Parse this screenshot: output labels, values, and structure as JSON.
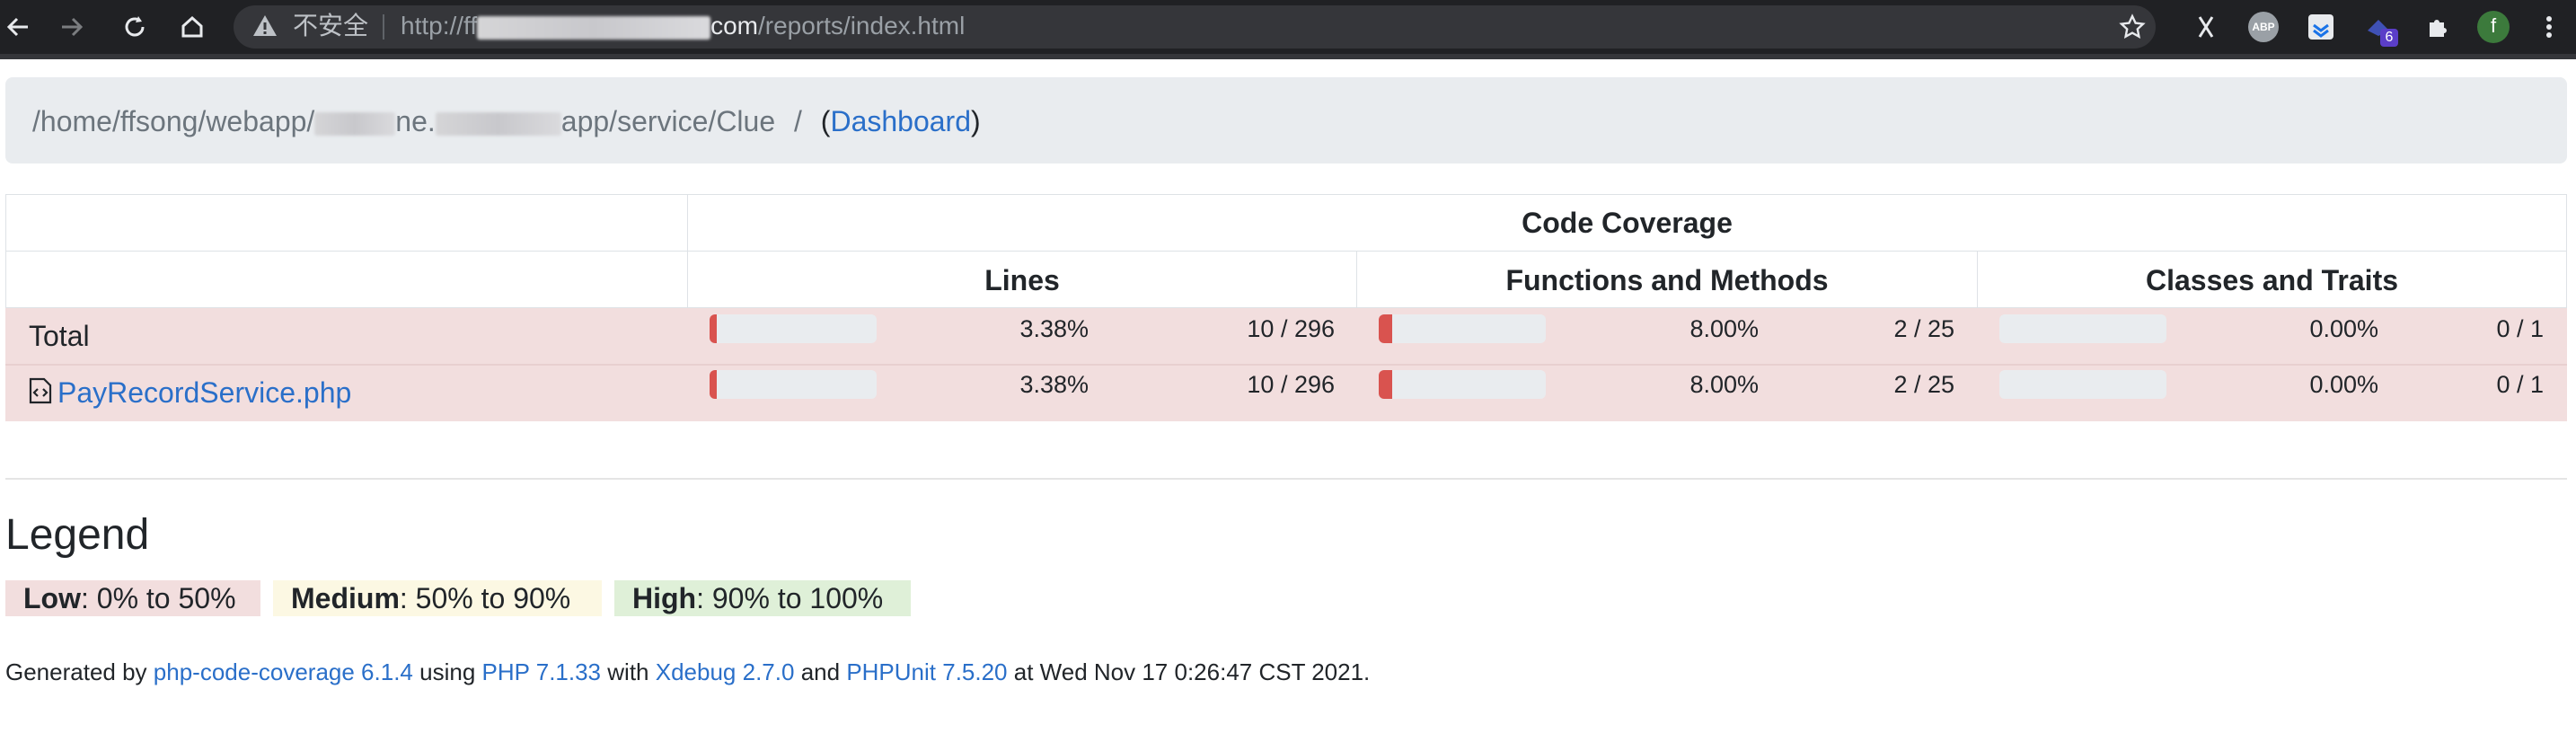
{
  "browser": {
    "security_label": "不安全",
    "url_scheme_prefix": "http://ff",
    "url_host_tail": "com",
    "url_path": "/reports/index.html",
    "extension_badge_count": "6",
    "profile_initial": "f",
    "abp_label": "ABP",
    "colors": {
      "profile": "#3c7a3c",
      "badge": "#5b3ec8"
    }
  },
  "breadcrumb": {
    "path_prefix": "/home/ffsong/webapp/",
    "path_mid": "ne.",
    "path_suffix": "app/service/Clue",
    "separator": "/",
    "open_paren": "(",
    "dashboard_link": "Dashboard",
    "close_paren": ")"
  },
  "table": {
    "group_header": "Code Coverage",
    "columns": [
      "Lines",
      "Functions and Methods",
      "Classes and Traits"
    ],
    "rows": [
      {
        "name": "Total",
        "is_link": false,
        "lines": {
          "pct": "3.38%",
          "count": "10 / 296",
          "fraction": 0.0338
        },
        "functions": {
          "pct": "8.00%",
          "count": "2 / 25",
          "fraction": 0.08
        },
        "classes": {
          "pct": "0.00%",
          "count": "0 / 1",
          "fraction": 0.0
        }
      },
      {
        "name": "PayRecordService.php",
        "is_link": true,
        "icon": "file-code-icon",
        "lines": {
          "pct": "3.38%",
          "count": "10 / 296",
          "fraction": 0.0338
        },
        "functions": {
          "pct": "8.00%",
          "count": "2 / 25",
          "fraction": 0.08
        },
        "classes": {
          "pct": "0.00%",
          "count": "0 / 1",
          "fraction": 0.0
        }
      }
    ],
    "colors": {
      "low_row": "#f2dede",
      "bar_fill": "#d9534f",
      "bar_track": "#e9ecef"
    }
  },
  "legend": {
    "title": "Legend",
    "items": [
      {
        "label": "Low",
        "range": ": 0% to 50%",
        "color": "#f2dede"
      },
      {
        "label": "Medium",
        "range": ": 50% to 90%",
        "color": "#fcf8e3"
      },
      {
        "label": "High",
        "range": ": 90% to 100%",
        "color": "#dff0d8"
      }
    ]
  },
  "footer": {
    "generated_by": "Generated by",
    "tool": "php-code-coverage 6.1.4",
    "using": "using",
    "php": "PHP 7.1.33",
    "with": "with",
    "xdebug": "Xdebug 2.7.0",
    "and": "and",
    "phpunit": "PHPUnit 7.5.20",
    "at": "at Wed Nov 17 0:26:47 CST 2021."
  }
}
